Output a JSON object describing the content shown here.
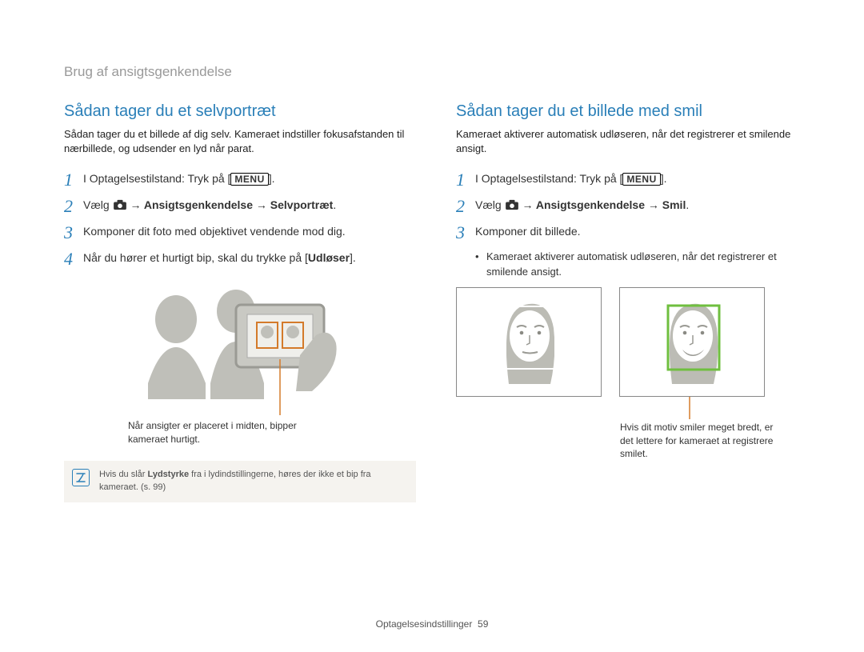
{
  "breadcrumb": "Brug af ansigtsgenkendelse",
  "left": {
    "heading": "Sådan tager du et selvportræt",
    "intro": "Sådan tager du et billede af dig selv. Kameraet indstiller fokusafstanden til nærbillede, og udsender en lyd når parat.",
    "step1_a": "I Optagelsestilstand: Tryk på [",
    "step1_menu": "MENU",
    "step1_b": "].",
    "step2_a": "Vælg ",
    "step2_b": " → Ansigtsgenkendelse → Selvportræt",
    "step2_c": ".",
    "step3": "Komponer dit foto med objektivet vendende mod dig.",
    "step4_a": "Når du hører et hurtigt bip, skal du trykke på [",
    "step4_b": "Udløser",
    "step4_c": "].",
    "caption": "Når ansigter er placeret i midten, bipper kameraet hurtigt.",
    "note_a": "Hvis du slår ",
    "note_b": "Lydstyrke",
    "note_c": " fra i lydindstillingerne, høres der ikke et bip fra kameraet. (s. 99)"
  },
  "right": {
    "heading": "Sådan tager du et billede med smil",
    "intro": "Kameraet aktiverer automatisk udløseren, når det registrerer et smilende ansigt.",
    "step1_a": "I Optagelsestilstand: Tryk på [",
    "step1_menu": "MENU",
    "step1_b": "].",
    "step2_a": "Vælg ",
    "step2_b": " → Ansigtsgenkendelse → Smil",
    "step2_c": ".",
    "step3": "Komponer dit billede.",
    "bullet": "Kameraet aktiverer automatisk udløseren, når det registrerer et smilende ansigt.",
    "caption": "Hvis dit motiv smiler meget bredt, er det lettere for kameraet at registrere smilet."
  },
  "footer_a": "Optagelsesindstillinger",
  "footer_b": "59"
}
